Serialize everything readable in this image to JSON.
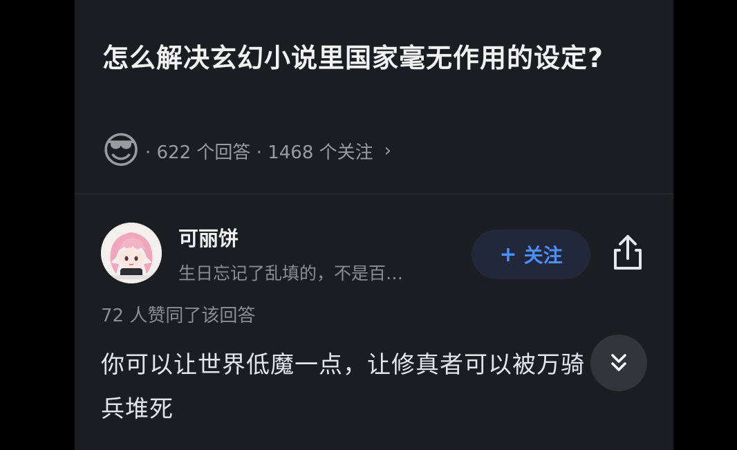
{
  "question": {
    "title": "怎么解决玄幻小说里国家毫无作用的设定?",
    "avatar_emoji": "😎",
    "meta": "· 622 个回答 · 1468 个关注",
    "chevron": "›"
  },
  "answer": {
    "author_name": "可丽饼",
    "author_bio": "生日忘记了乱填的，不是百…",
    "follow_plus": "+",
    "follow_label": "关注",
    "vote_text": "72 人赞同了该回答",
    "content": "你可以让世界低魔一点，让修真者可以被万骑兵堆死"
  },
  "icons": {
    "share": "share-icon",
    "expand": "double-chevron-down-icon",
    "avatar": "anime-girl-avatar"
  },
  "colors": {
    "background": "#1c1d21",
    "accent": "#4c8dff",
    "follow_bg": "#20283a",
    "secondary_text": "#8c8d92"
  }
}
